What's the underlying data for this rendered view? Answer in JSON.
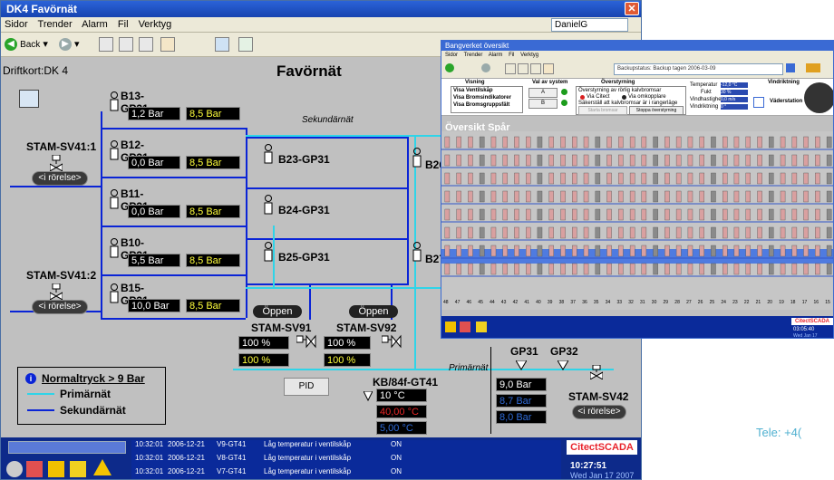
{
  "main_window": {
    "title": "DK4 Favörnät",
    "menu": [
      "Sidor",
      "Trender",
      "Alarm",
      "Fil",
      "Verktyg"
    ],
    "user": "DanielG",
    "back_label": "Back",
    "driftkort": "Driftkort:DK 4",
    "page_title": "Favörnät",
    "sekundar_label": "Sekundärnät",
    "primar_label": "Primärnät"
  },
  "sensors": [
    {
      "name": "B13-GP31",
      "value": "1,2 Bar",
      "setpoint": "8,5 Bar"
    },
    {
      "name": "B12-GP31",
      "value": "0,0 Bar",
      "setpoint": "8,5 Bar"
    },
    {
      "name": "B11-GP31",
      "value": "0,0 Bar",
      "setpoint": "8,5 Bar"
    },
    {
      "name": "B10-GP31",
      "value": "5,5 Bar",
      "setpoint": "8,5 Bar"
    },
    {
      "name": "B15-GP31",
      "value": "10,0 Bar",
      "setpoint": "8,5 Bar"
    }
  ],
  "mid_sensors": [
    "B23-GP31",
    "B24-GP31",
    "B25-GP31"
  ],
  "right_labels": [
    "B26",
    "B27"
  ],
  "valves": {
    "sv41_1": {
      "name": "STAM-SV41:1",
      "status": "<i rörelse>"
    },
    "sv41_2": {
      "name": "STAM-SV41:2",
      "status": "<i rörelse>"
    },
    "sv91": {
      "name": "STAM-SV91",
      "open": "Öppen",
      "val1": "100 %",
      "val2": "100 %"
    },
    "sv92": {
      "name": "STAM-SV92",
      "open": "Öppen",
      "val1": "100 %",
      "val2": "100 %"
    },
    "sv42": {
      "name": "STAM-SV42",
      "status": "<i rörelse>"
    }
  },
  "pid_label": "PID",
  "kb": {
    "name": "KB/84f-GT41",
    "temps": [
      "10 °C",
      "40,00 °C",
      "5,00 °C"
    ]
  },
  "gp": {
    "gp31": "GP31",
    "gp32": "GP32",
    "values": [
      "9,0 Bar",
      "8,7 Bar",
      "8,0 Bar"
    ]
  },
  "legend": {
    "title": "Normaltryck > 9 Bar",
    "items": [
      "Primärnät",
      "Sekundärnät"
    ]
  },
  "alarms": [
    {
      "time": "10:32:01",
      "date": "2006-12-21",
      "tag": "V9-GT41",
      "desc": "Låg temperatur i ventilskåp",
      "state": "ON"
    },
    {
      "time": "10:32:01",
      "date": "2006-12-21",
      "tag": "V8-GT41",
      "desc": "Låg temperatur i ventilskåp",
      "state": "ON"
    },
    {
      "time": "10:32:01",
      "date": "2006-12-21",
      "tag": "V7-GT41",
      "desc": "Låg temperatur i ventilskåp",
      "state": "ON"
    }
  ],
  "brand": "CitectSCADA",
  "clock": {
    "time": "10:27:51",
    "date": "Wed Jan 17 2007"
  },
  "colors": {
    "pipe_sek": "#0a24d6",
    "pipe_prim": "#2fd4e8",
    "brand_red": "#e8242c",
    "alarm_bg": "#0d2a8a"
  },
  "second_window": {
    "title": "Bangverket översikt",
    "menu": [
      "Sidor",
      "Trender",
      "Alarm",
      "Fil",
      "Verktyg"
    ],
    "backup": "Backupstatus: Backup tagen 2006-03-09",
    "visning": {
      "title": "Visning",
      "items": [
        "Visa Ventilskåp",
        "Visa Bromsindikatorer",
        "Visa Bromsgruppsfält"
      ]
    },
    "val_av_system": {
      "title": "Val av system",
      "buttons": [
        "A",
        "B"
      ]
    },
    "overstyrning": {
      "title": "Överstyrning",
      "items": [
        "Överstyrning av rörlig kalvbromsar",
        "Via Citect",
        "Via omkopplare",
        "Säkerställ att kalvbromsar är i rangerläge"
      ],
      "buttons": [
        "Starta bromsar",
        "Stoppa överstyrning"
      ]
    },
    "weather": {
      "labels": [
        "Temperatur",
        "Fukt",
        "Vindhastighet",
        "Vindriktning"
      ],
      "values": [
        "-12,0 °C",
        "30 %",
        "0,0 m/s",
        "0 °"
      ]
    },
    "vindriktning": "Vindriktning",
    "vaderstation": "Väderstation",
    "grid_title": "Översikt Spår",
    "tracks": [
      "48",
      "47",
      "46",
      "45",
      "44",
      "43",
      "42",
      "41",
      "40",
      "39",
      "38",
      "37",
      "36",
      "35",
      "34",
      "33",
      "32",
      "31",
      "30",
      "29",
      "28",
      "27",
      "26",
      "25",
      "24",
      "23",
      "22",
      "21",
      "20",
      "19",
      "18",
      "17",
      "16",
      "15"
    ],
    "brand": "CitectSCADA",
    "clock": {
      "time": "03:05:40",
      "date": "Wed Jan 17"
    }
  },
  "tele_text": "Tele: +4("
}
